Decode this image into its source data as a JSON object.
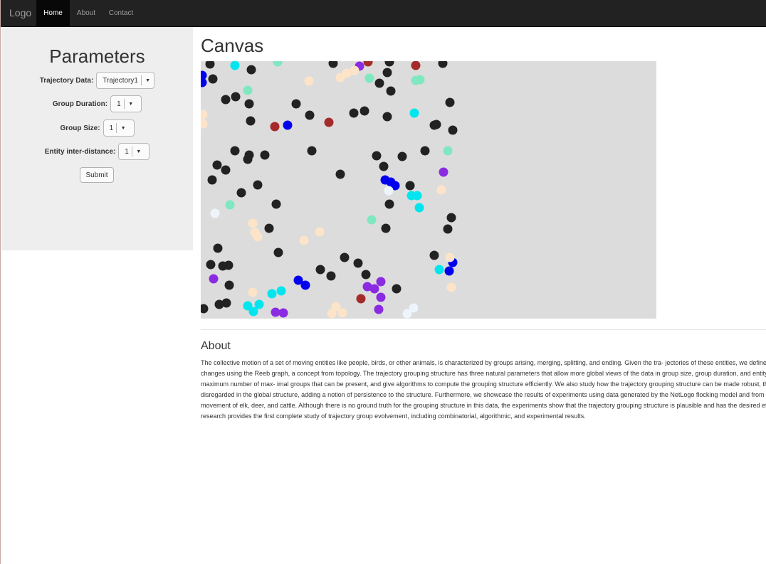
{
  "nav": {
    "brand": "Logo",
    "items": [
      {
        "label": "Home",
        "active": true
      },
      {
        "label": "About",
        "active": false
      },
      {
        "label": "Contact",
        "active": false
      }
    ]
  },
  "sidebar": {
    "title": "Parameters",
    "fields": [
      {
        "label": "Trajectory Data:",
        "value": "Trajectory1"
      },
      {
        "label": "Group Duration:",
        "value": "1"
      },
      {
        "label": "Group Size:",
        "value": "1"
      },
      {
        "label": "Entity inter-distance:",
        "value": "1"
      }
    ],
    "submit_label": "Submit"
  },
  "canvas": {
    "title": "Canvas",
    "background": "#dcdcdc",
    "colors": {
      "black": "#222222",
      "blue": "#0000ee",
      "cyan": "#00e5ee",
      "aquamarine": "#7fe8c0",
      "purple": "#8a2be2",
      "brown": "#a52a2a",
      "bisque": "#fde4c8",
      "aliceblue": "#eef4fb"
    }
  },
  "about": {
    "title": "About",
    "lines": [
      "The collective motion of a set of moving entities like people, birds, or other animals, is characterized by groups arising, merging, splitting, and ending. Given the tra- jectories of these entities, we define and model a structure that captures all of such",
      "changes using the Reeb graph, a concept from topology. The trajectory grouping structure has three natural parameters that allow more global views of the data in group size, group duration, and entity inter-distance. We prove complexity bounds on the",
      "maximum number of max- imal groups that can be present, and give algorithms to compute the grouping structure efficiently. We also study how the trajectory grouping structure can be made robust, that is, how brief interruptions of groups can be",
      "disregarded in the global structure, adding a notion of persistence to the structure. Furthermore, we showcase the results of experiments using data generated by the NetLogo flocking model and from the Starkey project. The Starkey data describe the",
      "movement of elk, deer, and cattle. Although there is no ground truth for the grouping structure in this data, the experiments show that the trajectory grouping structure is plausible and has the desired effects when changing the essential parameters. Our",
      "research provides the first complete study of trajectory group evolvement, including combinatorial, algorithmic, and experimental results."
    ]
  }
}
